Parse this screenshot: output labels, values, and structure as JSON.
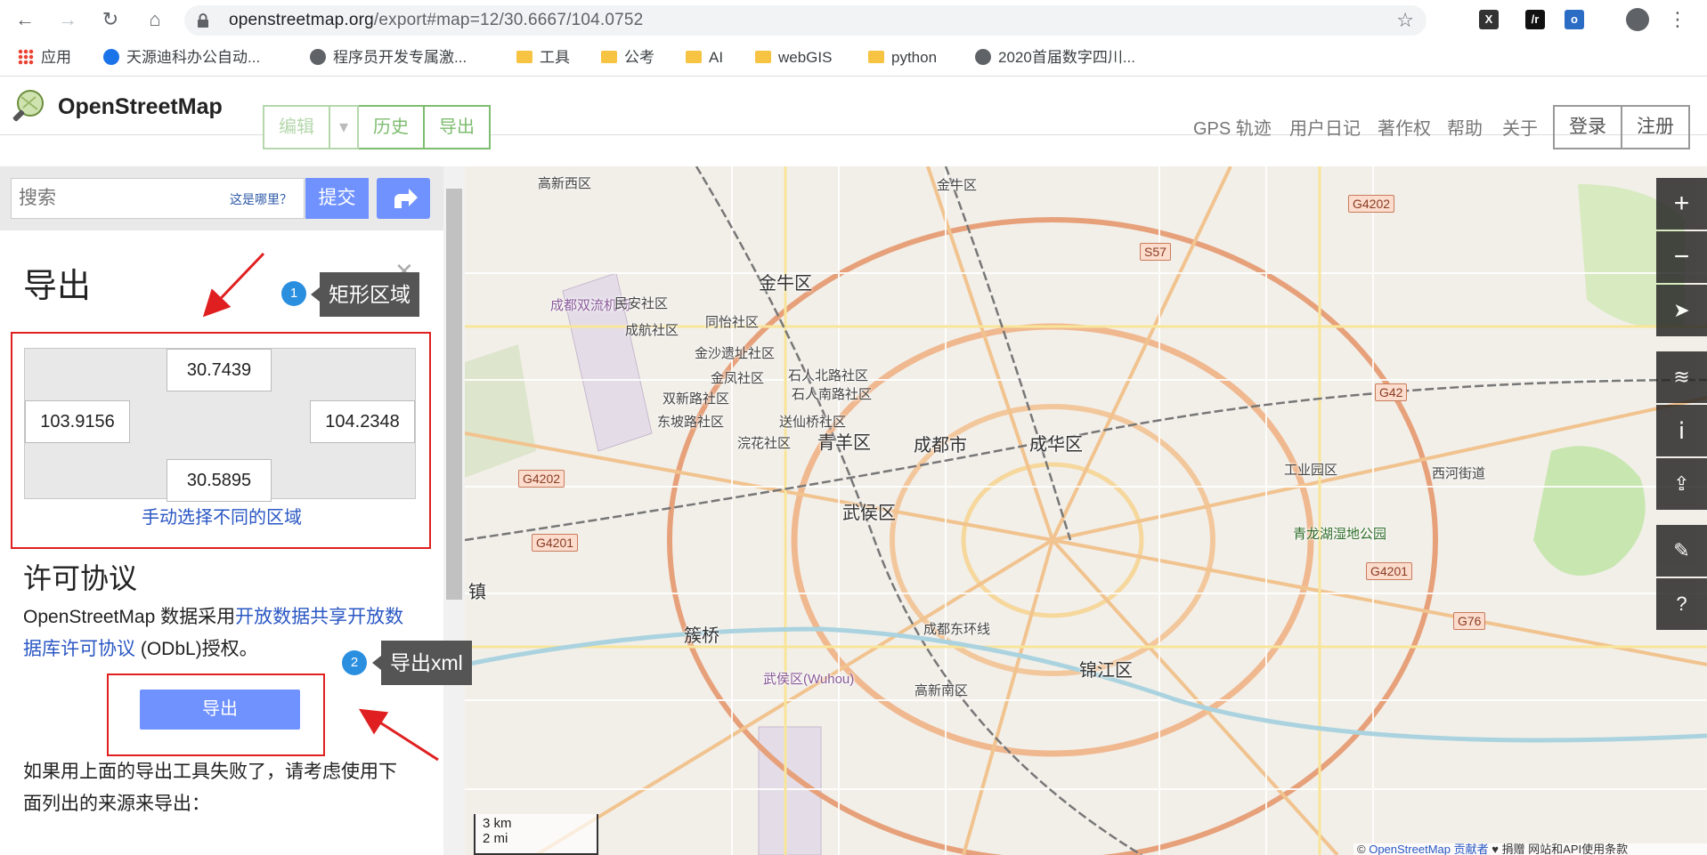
{
  "browser": {
    "url_host": "openstreetmap.org",
    "url_path": "/export#map=12/30.6667/104.0752",
    "bookmarks": [
      "应用",
      "天源迪科办公自动...",
      "程序员开发专属激...",
      "工具",
      "公考",
      "AI",
      "webGIS",
      "python",
      "2020首届数字四川..."
    ]
  },
  "header": {
    "brand": "OpenStreetMap",
    "buttons": [
      "编辑",
      "历史",
      "导出"
    ],
    "nav": [
      "GPS 轨迹",
      "用户日记",
      "著作权",
      "帮助",
      "关于"
    ],
    "login": "登录",
    "signup": "注册"
  },
  "search": {
    "placeholder": "搜索",
    "where": "这是哪里？",
    "submit": "提交"
  },
  "export_panel": {
    "title": "导出",
    "north": "30.7439",
    "west": "103.9156",
    "east": "104.2348",
    "south": "30.5895",
    "manual_select": "手动选择不同的区域",
    "license_title": "许可协议",
    "license_prefix": "OpenStreetMap 数据采用",
    "license_link": "开放数据共享开放数据库许可协议",
    "license_suffix": " (ODbL)授权。",
    "export_button": "导出",
    "fail_text": "如果用上面的导出工具失败了，请考虑使用下面列出的来源来导出："
  },
  "annotations": {
    "step1_num": "1",
    "step1_label": "矩形区域",
    "step2_num": "2",
    "step2_label": "导出xml"
  },
  "map": {
    "labels": [
      "高新西区",
      "金牛区",
      "成都双流机场",
      "民安社区",
      "成航社区",
      "同怡社区",
      "金沙遗址社区",
      "金凤社区",
      "石人北路社区",
      "石人南路社区",
      "双新路社区",
      "东坡路社区",
      "送仙桥社区",
      "浣花社区",
      "青羊区",
      "成都市",
      "成华区",
      "武侯区",
      "簇桥",
      "锦江区",
      "工业园区",
      "青龙湖湿地公园",
      "西河街道",
      "金牛区",
      "成都东环线",
      "武侯区(Wuhou)",
      "高新南区",
      "镇"
    ],
    "shields": [
      "G4202",
      "S57",
      "G4202",
      "G42",
      "G4201",
      "G4201",
      "G76"
    ],
    "scale_km": "3 km",
    "scale_mi": "2 mi",
    "attribution_prefix": "© ",
    "attribution_link": "OpenStreetMap 贡献者",
    "attribution_rest": " ♥ 捐赠 网站和API使用条款"
  },
  "colors": {
    "osm_green": "#7ebc6f",
    "button_blue": "#7092ff",
    "link_blue": "#2a57c4",
    "annotation_red": "#e02020"
  }
}
